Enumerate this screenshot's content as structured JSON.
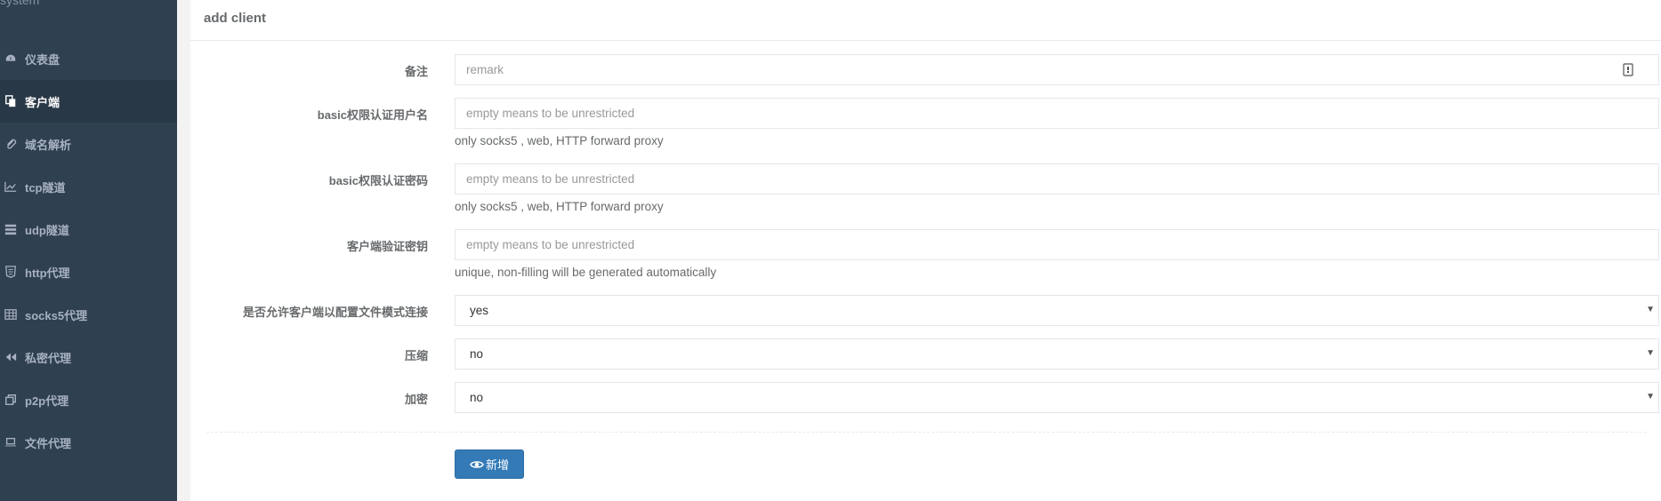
{
  "sidebar": {
    "brand": "system",
    "items": [
      {
        "label": "仪表盘",
        "icon": "dashboard-icon"
      },
      {
        "label": "客户端",
        "icon": "copy-icon",
        "active": true
      },
      {
        "label": "域名解析",
        "icon": "paperclip-icon"
      },
      {
        "label": "tcp隧道",
        "icon": "line-chart-icon"
      },
      {
        "label": "udp隧道",
        "icon": "server-icon"
      },
      {
        "label": "http代理",
        "icon": "html5-icon"
      },
      {
        "label": "socks5代理",
        "icon": "table-icon"
      },
      {
        "label": "私密代理",
        "icon": "backward-icon"
      },
      {
        "label": "p2p代理",
        "icon": "clone-icon"
      },
      {
        "label": "文件代理",
        "icon": "laptop-icon"
      }
    ]
  },
  "panel": {
    "title": "add client",
    "fields": {
      "remark": {
        "label": "备注",
        "placeholder": "remark",
        "value": ""
      },
      "basic_user": {
        "label": "basic权限认证用户名",
        "placeholder": "empty means to be unrestricted",
        "value": "",
        "help": "only socks5 , web, HTTP forward proxy"
      },
      "basic_password": {
        "label": "basic权限认证密码",
        "placeholder": "empty means to be unrestricted",
        "value": "",
        "help": "only socks5 , web, HTTP forward proxy"
      },
      "verify_key": {
        "label": "客户端验证密钥",
        "placeholder": "empty means to be unrestricted",
        "value": "",
        "help": "unique, non-filling will be generated automatically"
      },
      "config_conn": {
        "label": "是否允许客户端以配置文件模式连接",
        "value": "yes"
      },
      "compress": {
        "label": "压缩",
        "value": "no"
      },
      "crypt": {
        "label": "加密",
        "value": "no"
      }
    },
    "submit_label": "新增"
  },
  "colors": {
    "sidebar_bg": "#2f4050",
    "sidebar_active_bg": "#293846",
    "primary": "#337ab7"
  }
}
